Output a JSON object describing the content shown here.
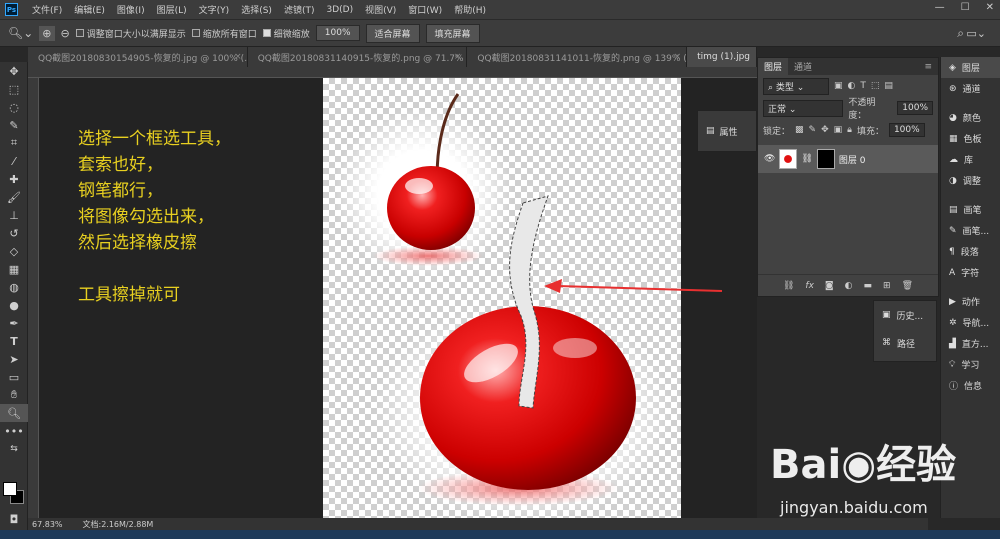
{
  "app": {
    "logo_text": "Ps"
  },
  "menu": [
    "文件(F)",
    "编辑(E)",
    "图像(I)",
    "图层(L)",
    "文字(Y)",
    "选择(S)",
    "滤镜(T)",
    "3D(D)",
    "视图(V)",
    "窗口(W)",
    "帮助(H)"
  ],
  "window_controls": {
    "minimize": "—",
    "maximize": "☐",
    "close": "✕"
  },
  "options": {
    "resize_windows": "调整窗口大小以满屏显示",
    "zoom_all": "缩放所有窗口",
    "scrubby_zoom": "细微缩放",
    "zoom_value": "100%",
    "fit_screen": "适合屏幕",
    "fill_screen": "填充屏幕"
  },
  "tabs": [
    {
      "label": "QQ截图20180830154905-恢复的.jpg @ 100% (..."
    },
    {
      "label": "QQ截图20180831140915-恢复的.png @ 71.7% (..."
    },
    {
      "label": "QQ截图20180831141011-恢复的.png @ 139% (..."
    },
    {
      "label": "timg (1).jpg"
    }
  ],
  "instructions": "选择一个框选工具，\n套索也好，\n钢笔都行，\n将图像勾选出来，\n然后选择橡皮擦\n\n工具擦掉就可",
  "properties_panel": {
    "label": "属性"
  },
  "history_panel": {
    "history": "历史...",
    "paths": "路径"
  },
  "layers_panel": {
    "tab_layers": "图层",
    "tab_channels": "通道",
    "filter_kind": "类型",
    "blend_mode": "正常",
    "opacity_label": "不透明度：",
    "opacity_value": "100%",
    "lock_label": "锁定：",
    "fill_label": "填充：",
    "fill_value": "100%",
    "layer_name": "图层 0"
  },
  "right_panel": {
    "layers": "图层",
    "channels": "通道",
    "color": "颜色",
    "swatches": "色板",
    "libraries": "库",
    "adjustments": "调整",
    "brush": "画笔",
    "brush_presets": "画笔...",
    "paragraph": "段落",
    "character": "字符",
    "actions": "动作",
    "navigator": "导航...",
    "histogram": "直方...",
    "learn": "学习",
    "info": "信息"
  },
  "status": {
    "zoom": "67.83%",
    "doc": "文档:2.16M/2.88M"
  },
  "watermark": {
    "logo": "Bai◉经验",
    "url": "jingyan.baidu.com"
  },
  "colors": {
    "instruction_text": "#e8d020",
    "arrow": "#e83030",
    "cherry": "#e01010"
  }
}
